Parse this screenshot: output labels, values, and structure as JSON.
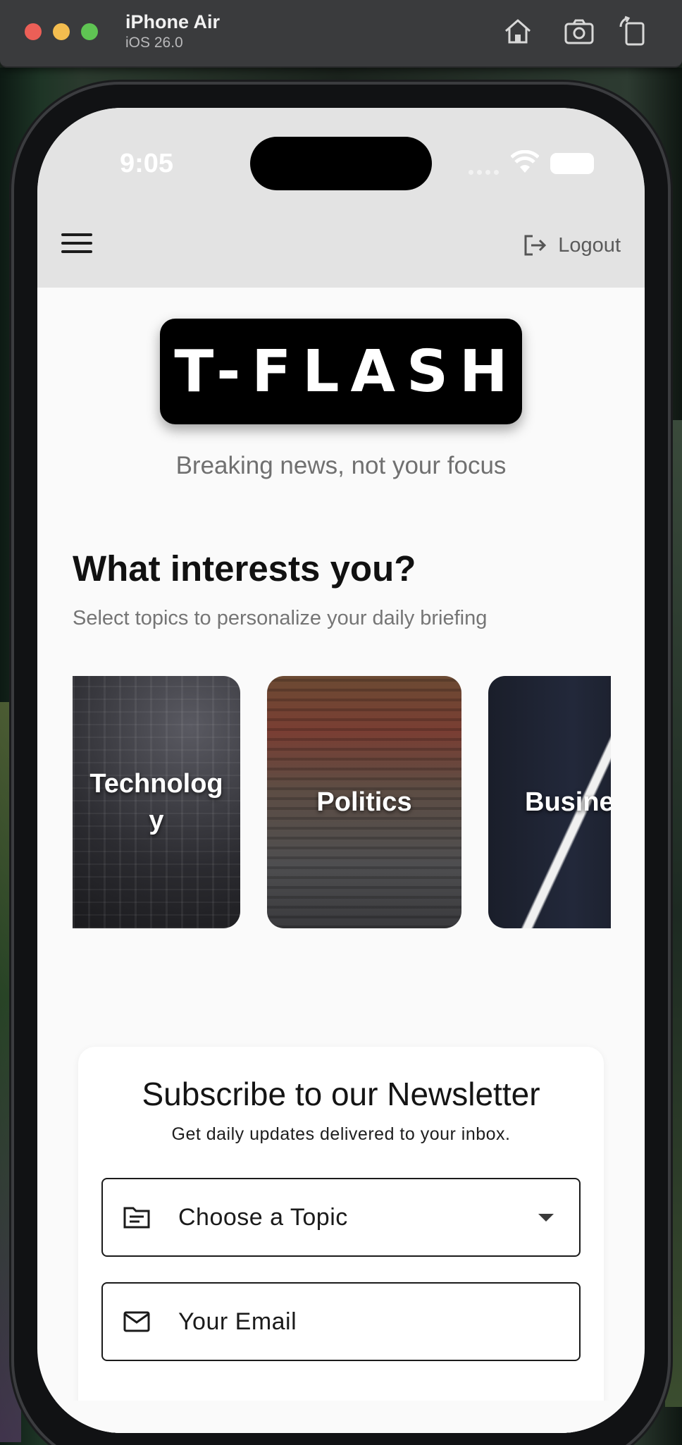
{
  "simulator": {
    "device_name": "iPhone Air",
    "os_version": "iOS 26.0",
    "toolbar_icons": [
      "home-icon",
      "screenshot-icon",
      "rotate-icon"
    ]
  },
  "status_bar": {
    "time": "9:05"
  },
  "header": {
    "logout_label": "Logout"
  },
  "brand": {
    "logo": "T-FLASH",
    "tagline": "Breaking news, not your focus"
  },
  "topics_section": {
    "title": "What interests you?",
    "subtitle": "Select topics to personalize your daily briefing",
    "cards": [
      {
        "label": "Technolog\ny"
      },
      {
        "label": "Politics"
      },
      {
        "label": "Busine"
      }
    ]
  },
  "newsletter": {
    "title": "Subscribe to our Newsletter",
    "subtitle": "Get daily updates delivered to your inbox.",
    "topic_select_placeholder": "Choose a Topic",
    "email_placeholder": "Your Email"
  },
  "colors": {
    "logo_bg": "#000000",
    "header_bg": "#e3e3e3",
    "page_bg": "#fafafa",
    "traffic_red": "#ec5f57",
    "traffic_yellow": "#f4bd4f",
    "traffic_green": "#5fc453"
  }
}
